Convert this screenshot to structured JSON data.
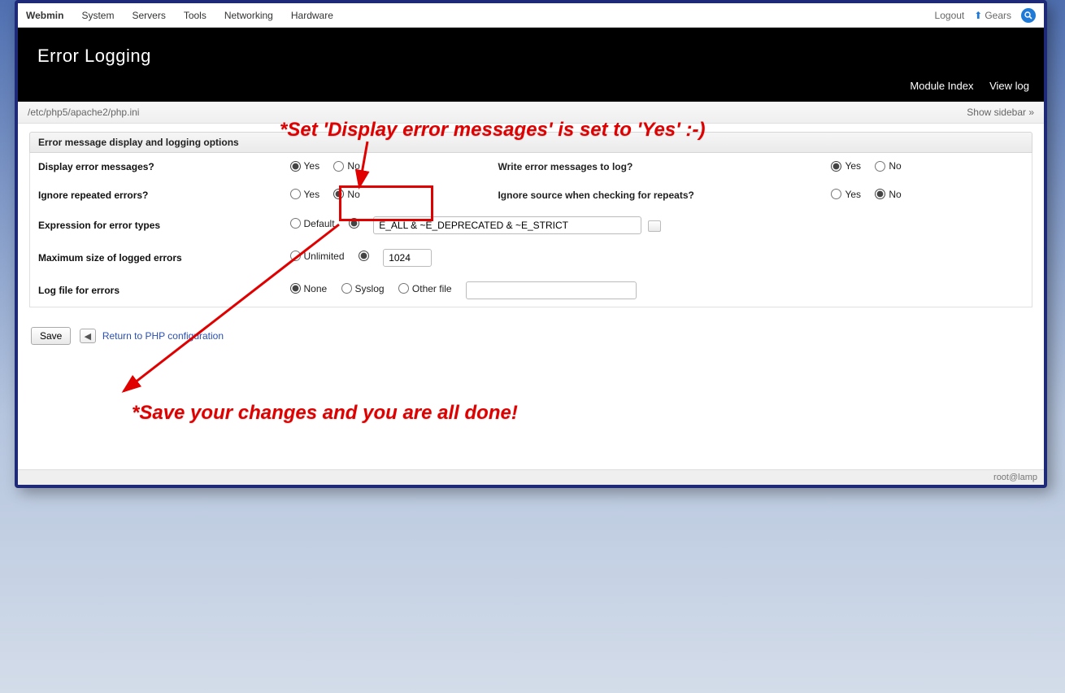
{
  "nav": {
    "items": [
      "Webmin",
      "System",
      "Servers",
      "Tools",
      "Networking",
      "Hardware"
    ],
    "logout": "Logout",
    "gears": "Gears"
  },
  "header": {
    "title": "Error Logging",
    "module_index": "Module Index",
    "view_log": "View log"
  },
  "subbar": {
    "path": "/etc/php5/apache2/php.ini",
    "show_sidebar": "Show sidebar »"
  },
  "section": {
    "title": "Error message display and logging options"
  },
  "form": {
    "display_errors_label": "Display error messages?",
    "write_log_label": "Write error messages to log?",
    "ignore_repeated_label": "Ignore repeated errors?",
    "ignore_source_label": "Ignore source when checking for repeats?",
    "expression_label": "Expression for error types",
    "maxsize_label": "Maximum size of logged errors",
    "logfile_label": "Log file for errors",
    "yes": "Yes",
    "no": "No",
    "default": "Default",
    "unlimited": "Unlimited",
    "none": "None",
    "syslog": "Syslog",
    "other_file": "Other file",
    "expression_value": "E_ALL & ~E_DEPRECATED & ~E_STRICT",
    "maxsize_value": "1024",
    "otherfile_value": "",
    "save": "Save"
  },
  "return_link": "Return to PHP configuration",
  "footer": "root@lamp",
  "annotations": {
    "text1": "*Set 'Display error messages' is set to 'Yes' :-)",
    "text2": "*Save your changes and you are all done!"
  }
}
